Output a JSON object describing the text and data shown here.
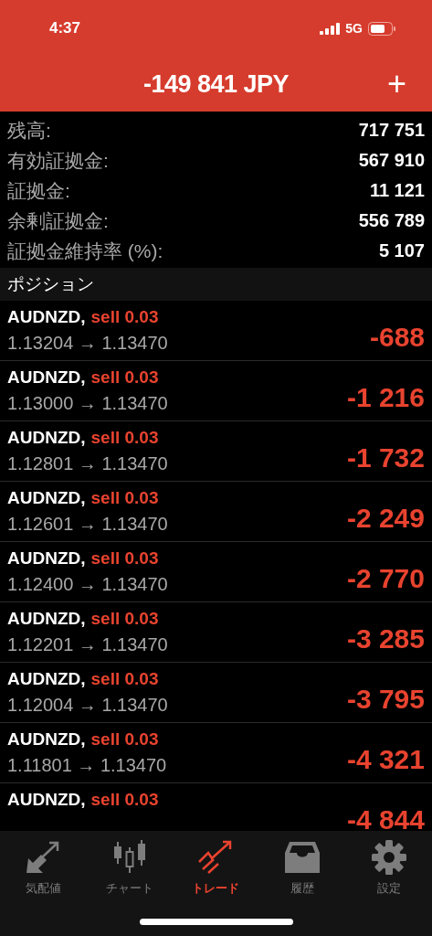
{
  "status_bar": {
    "time": "4:37",
    "network": "5G"
  },
  "header": {
    "title": "-149 841 JPY",
    "add": "+"
  },
  "summary": [
    {
      "label": "残高:",
      "value": "717 751"
    },
    {
      "label": "有効証拠金:",
      "value": "567 910"
    },
    {
      "label": "証拠金:",
      "value": "11 121"
    },
    {
      "label": "余剰証拠金:",
      "value": "556 789"
    },
    {
      "label": "証拠金維持率 (%):",
      "value": "5 107"
    }
  ],
  "section_title": "ポジション",
  "positions": [
    {
      "symbol": "AUDNZD,",
      "order": "sell 0.03",
      "prices": "1.13204 → 1.13470",
      "profit": "-688"
    },
    {
      "symbol": "AUDNZD,",
      "order": "sell 0.03",
      "prices": "1.13000 → 1.13470",
      "profit": "-1 216"
    },
    {
      "symbol": "AUDNZD,",
      "order": "sell 0.03",
      "prices": "1.12801 → 1.13470",
      "profit": "-1 732"
    },
    {
      "symbol": "AUDNZD,",
      "order": "sell 0.03",
      "prices": "1.12601 → 1.13470",
      "profit": "-2 249"
    },
    {
      "symbol": "AUDNZD,",
      "order": "sell 0.03",
      "prices": "1.12400 → 1.13470",
      "profit": "-2 770"
    },
    {
      "symbol": "AUDNZD,",
      "order": "sell 0.03",
      "prices": "1.12201 → 1.13470",
      "profit": "-3 285"
    },
    {
      "symbol": "AUDNZD,",
      "order": "sell 0.03",
      "prices": "1.12004 → 1.13470",
      "profit": "-3 795"
    },
    {
      "symbol": "AUDNZD,",
      "order": "sell 0.03",
      "prices": "1.11801 → 1.13470",
      "profit": "-4 321"
    },
    {
      "symbol": "AUDNZD,",
      "order": "sell 0.03",
      "profit": "-4 844"
    }
  ],
  "tabs": [
    {
      "kind": "quotes",
      "label": "気配値",
      "selected": false
    },
    {
      "kind": "chart",
      "label": "チャート",
      "selected": false
    },
    {
      "kind": "trade",
      "label": "トレード",
      "selected": true
    },
    {
      "kind": "history",
      "label": "履歴",
      "selected": false
    },
    {
      "kind": "settings",
      "label": "設定",
      "selected": false
    }
  ]
}
